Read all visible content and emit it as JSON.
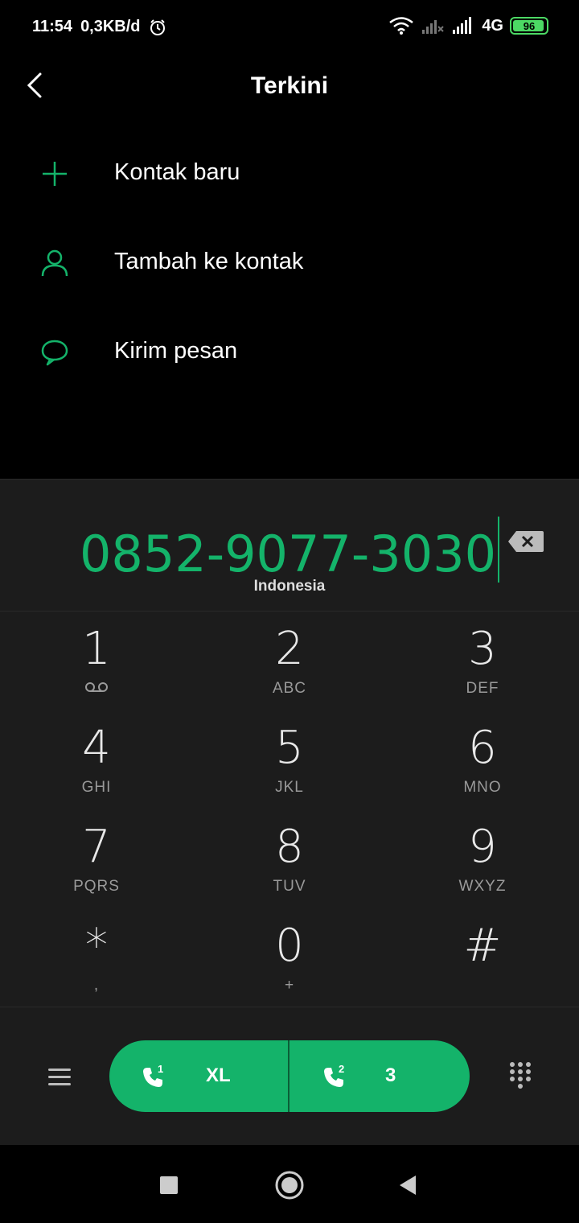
{
  "status_bar": {
    "time": "11:54",
    "speed": "0,3KB/d",
    "network": "4G",
    "battery": "96",
    "battery_level": 0.96
  },
  "header": {
    "title": "Terkini"
  },
  "options": [
    {
      "label": "Kontak baru",
      "icon": "plus-icon"
    },
    {
      "label": "Tambah ke kontak",
      "icon": "person-icon"
    },
    {
      "label": "Kirim pesan",
      "icon": "chat-bubble-icon"
    }
  ],
  "dialer": {
    "number": "0852-9077-3030",
    "region": "Indonesia",
    "keys": [
      {
        "digit": "1",
        "letters": ""
      },
      {
        "digit": "2",
        "letters": "ABC"
      },
      {
        "digit": "3",
        "letters": "DEF"
      },
      {
        "digit": "4",
        "letters": "GHI"
      },
      {
        "digit": "5",
        "letters": "JKL"
      },
      {
        "digit": "6",
        "letters": "MNO"
      },
      {
        "digit": "7",
        "letters": "PQRS"
      },
      {
        "digit": "8",
        "letters": "TUV"
      },
      {
        "digit": "9",
        "letters": "WXYZ"
      },
      {
        "digit": "*",
        "letters": ","
      },
      {
        "digit": "0",
        "letters": "+"
      },
      {
        "digit": "#",
        "letters": ""
      }
    ]
  },
  "call_bar": {
    "sim1": {
      "slot": "1",
      "carrier": "XL"
    },
    "sim2": {
      "slot": "2",
      "carrier": "3"
    }
  },
  "colors": {
    "accent": "#14b36a",
    "panel": "#1c1c1c",
    "background": "#000000"
  }
}
